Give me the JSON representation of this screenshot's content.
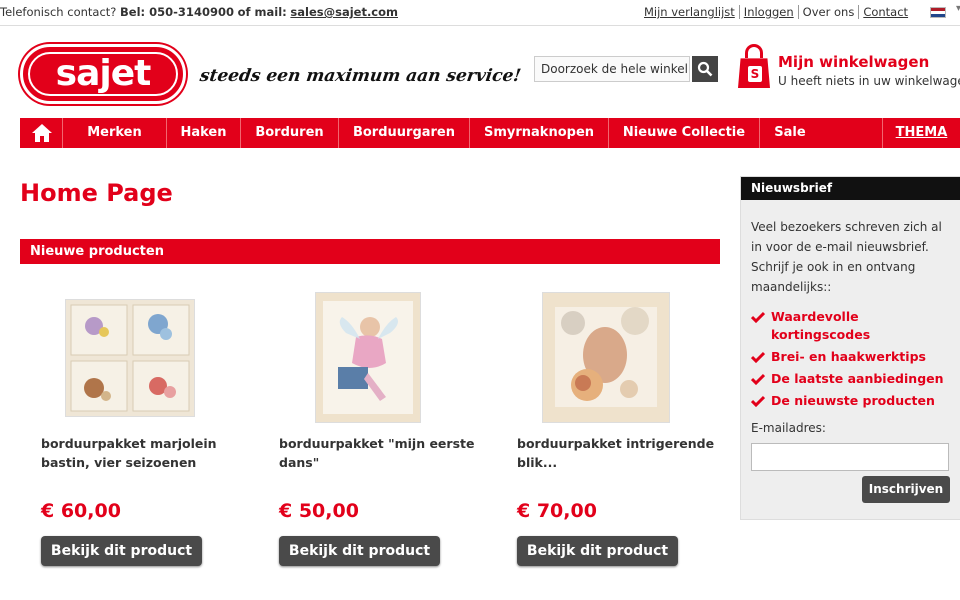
{
  "topbar": {
    "contact_prefix": "Telefonisch contact?",
    "phone_label": "Bel: 050-3140900",
    "mail_label": "of mail:",
    "email": "sales@sajet.com",
    "links": [
      "Mijn verlanglijst",
      "Inloggen",
      "Over ons",
      "Contact"
    ],
    "caret": "▾"
  },
  "header": {
    "logo_text": "sajet",
    "slogan": "steeds een maximum aan service!",
    "search_placeholder": "Doorzoek de hele winkel",
    "cart_title": "Mijn winkelwagen",
    "cart_subtitle": "U heeft niets in uw winkelwagen.",
    "bag_letter": "S"
  },
  "nav": {
    "items": [
      "Merken",
      "Haken",
      "Borduren",
      "Borduurgaren",
      "Smyrnaknopen",
      "Nieuwe Collectie",
      "Sale"
    ],
    "thema": "THEMA"
  },
  "main": {
    "page_title": "Home Page",
    "section_title": "Nieuwe producten",
    "products": [
      {
        "name": "borduurpakket marjolein bastin, vier seizoenen",
        "price": "€ 60,00",
        "button": "Bekijk dit product"
      },
      {
        "name": "borduurpakket \"mijn eerste dans\"",
        "price": "€ 50,00",
        "button": "Bekijk dit product"
      },
      {
        "name": "borduurpakket intrigerende blik...",
        "price": "€ 70,00",
        "button": "Bekijk dit product"
      }
    ]
  },
  "sidebar": {
    "title": "Nieuwsbrief",
    "text": "Veel bezoekers schreven zich al in voor de e-mail nieuwsbrief. Schrijf je ook in en ontvang maandelijks::",
    "benefits": [
      "Waardevolle kortingscodes",
      "Brei- en haakwerktips",
      "De laatste aanbiedingen",
      "De nieuwste producten"
    ],
    "email_label": "E-mailadres:",
    "subscribe_button": "Inschrijven"
  },
  "colors": {
    "brand_red": "#e2001a",
    "dark_button": "#4a4a4a"
  }
}
